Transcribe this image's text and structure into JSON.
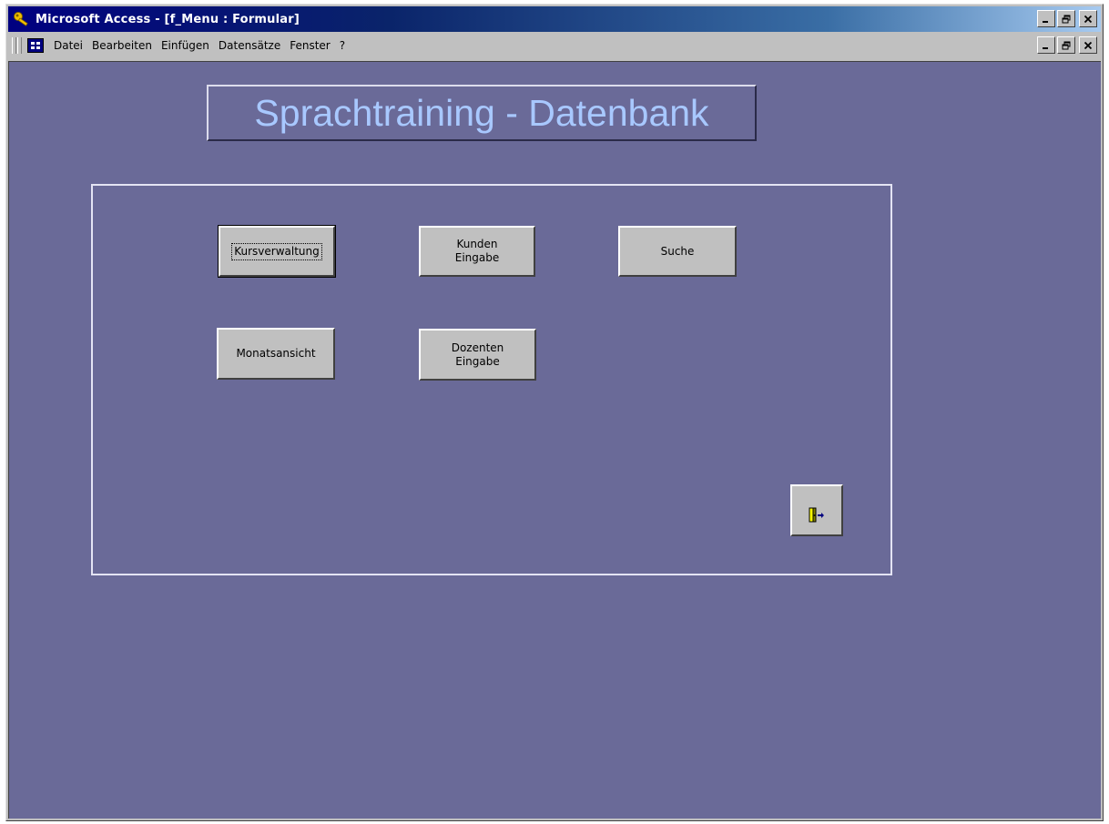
{
  "window": {
    "title": "Microsoft Access - [f_Menu : Formular]",
    "buttons": {
      "minimize": "_",
      "restore": "́",
      "close": "×"
    }
  },
  "menubar": {
    "items": [
      "Datei",
      "Bearbeiten",
      "Einfügen",
      "Datensätze",
      "Fenster",
      "?"
    ]
  },
  "form": {
    "title": "Sprachtraining - Datenbank",
    "background_color": "#6a6a98",
    "title_color": "#a8c8ff",
    "buttons": {
      "kursverwaltung": "Kursverwaltung",
      "kunden_eingabe": "Kunden\nEingabe",
      "suche": "Suche",
      "monatsansicht": "Monatsansicht",
      "dozenten_eingabe": "Dozenten\nEingabe",
      "exit_icon": "exit-door-icon"
    }
  }
}
